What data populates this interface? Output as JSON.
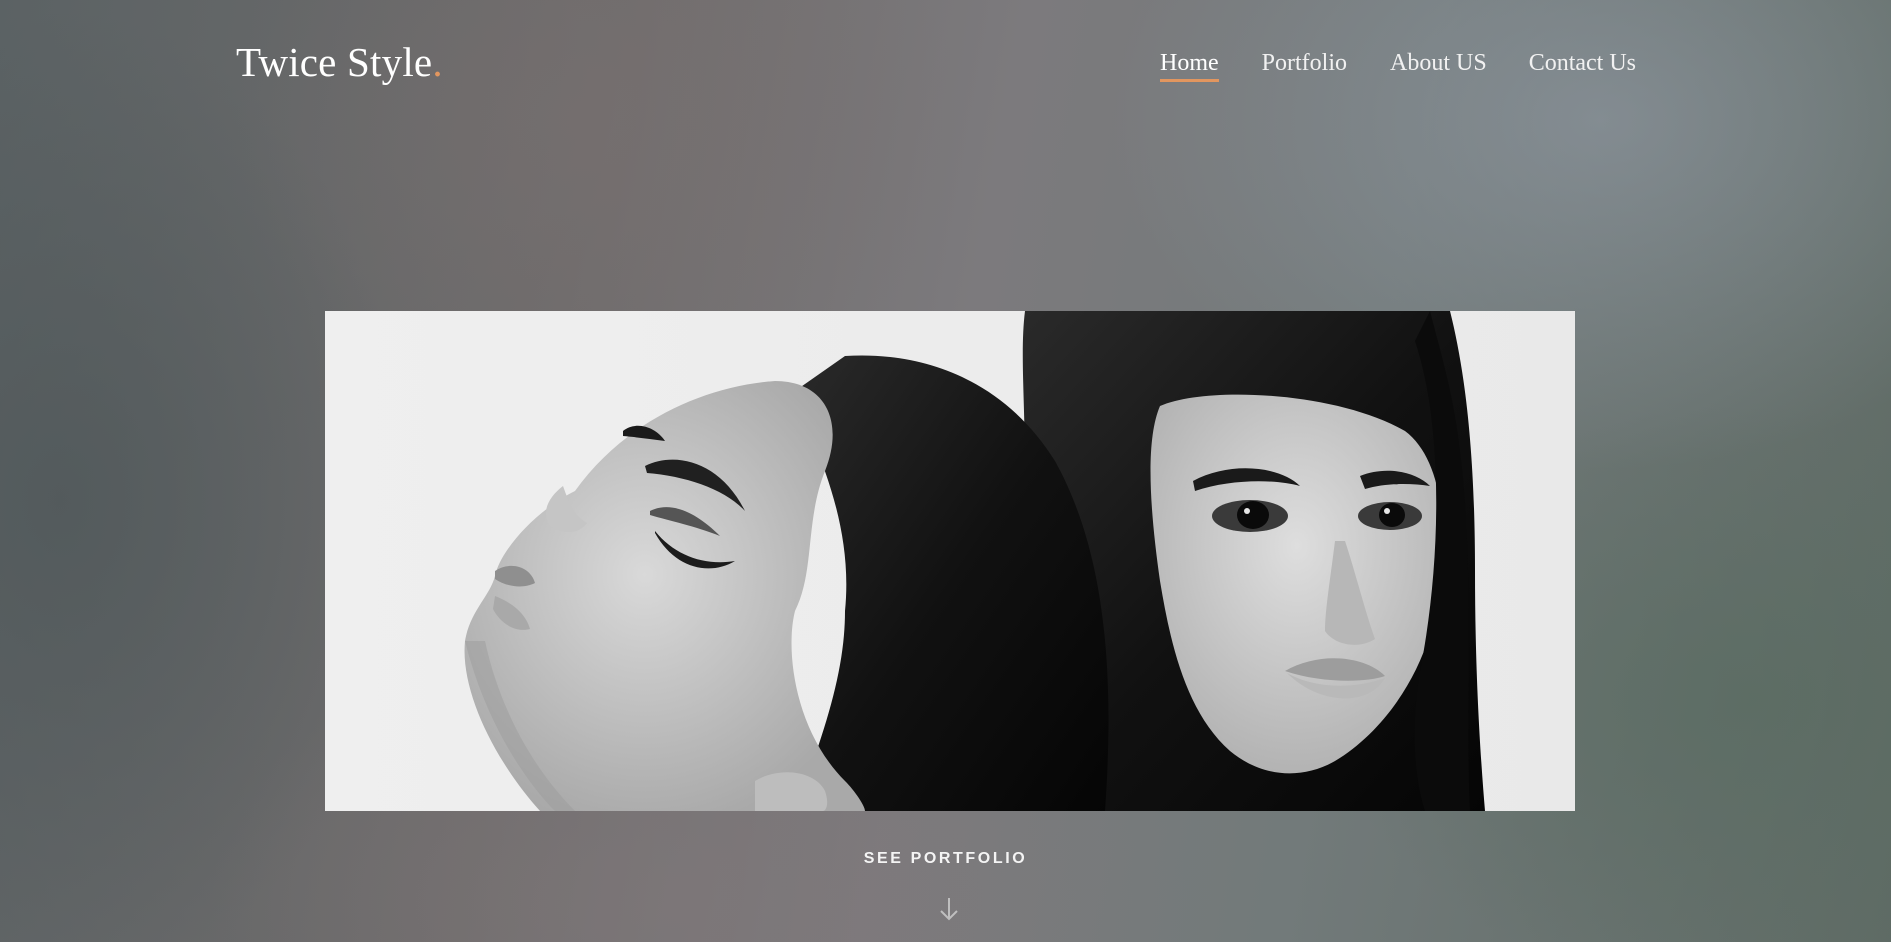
{
  "header": {
    "logo": {
      "text": "Twice Style",
      "dot": "."
    },
    "nav": [
      {
        "label": "Home",
        "active": true
      },
      {
        "label": "Portfolio",
        "active": false
      },
      {
        "label": "About US",
        "active": false
      },
      {
        "label": "Contact Us",
        "active": false
      }
    ]
  },
  "hero": {
    "image_alt": "Black and white photo of two women with dark hair"
  },
  "cta": {
    "label": "SEE PORTFOLIO",
    "icon": "arrow-down-icon"
  },
  "colors": {
    "accent": "#e2965f",
    "text": "#ffffff"
  }
}
